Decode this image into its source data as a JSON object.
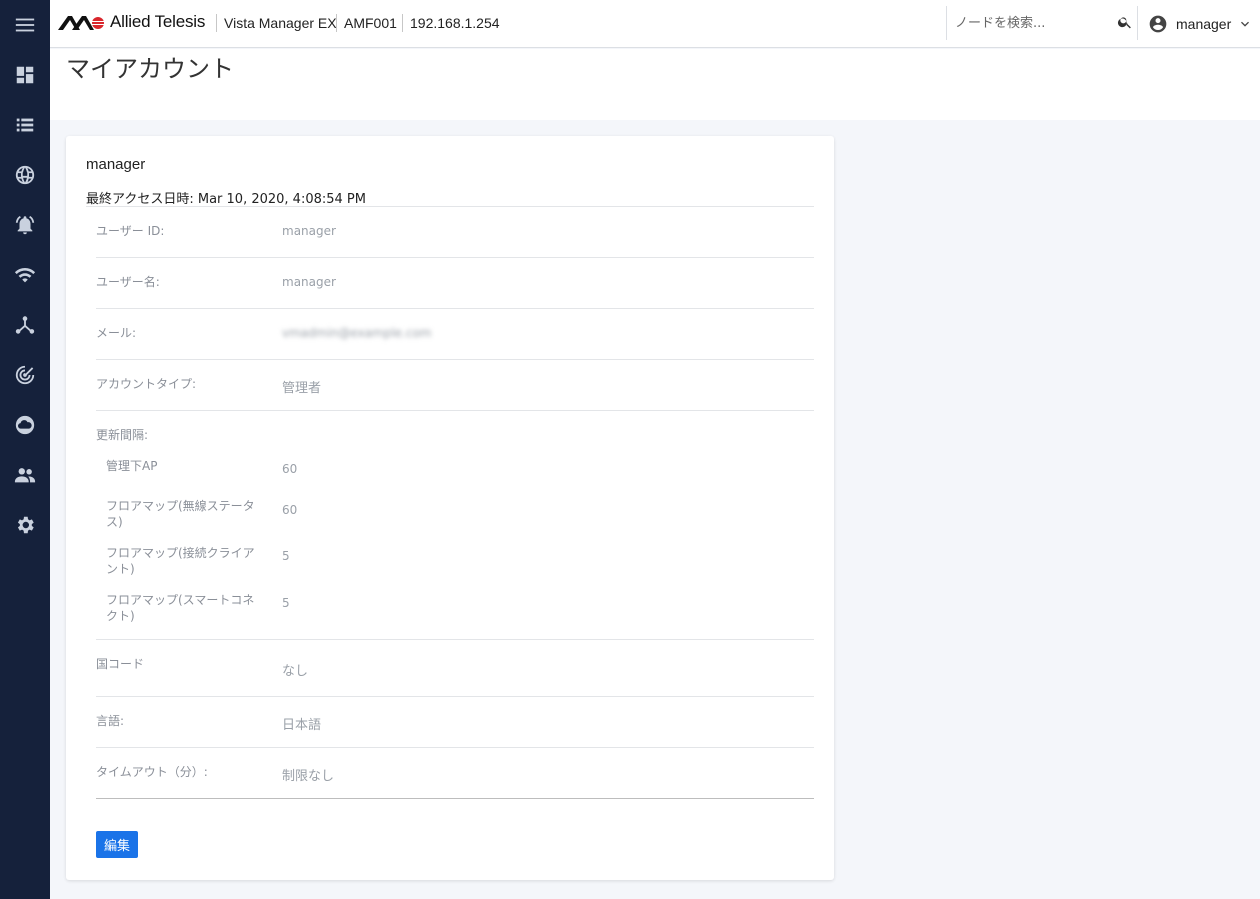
{
  "header": {
    "logo_text": "Allied Telesis",
    "product": "Vista Manager EX",
    "device": "AMF001",
    "ip": "192.168.1.254",
    "search_placeholder": "ノードを検索...",
    "user": "manager"
  },
  "sidebar": {
    "items": [
      {
        "icon": "menu-icon"
      },
      {
        "icon": "dashboard-icon"
      },
      {
        "icon": "list-icon"
      },
      {
        "icon": "globe-icon"
      },
      {
        "icon": "alarm-icon"
      },
      {
        "icon": "wifi-icon"
      },
      {
        "icon": "topology-icon"
      },
      {
        "icon": "radar-icon"
      },
      {
        "icon": "cloud-icon"
      },
      {
        "icon": "users-icon"
      },
      {
        "icon": "gear-icon"
      }
    ]
  },
  "page": {
    "title": "マイアカウント"
  },
  "account": {
    "username_heading": "manager",
    "last_access": "最終アクセス日時: Mar 10, 2020, 4:08:54 PM",
    "user_id_label": "ユーザー ID:",
    "user_id": "manager",
    "user_name_label": "ユーザー名:",
    "user_name": "manager",
    "mail_label": "メール:",
    "mail": "vmadmin@example.com",
    "account_type_label": "アカウントタイプ:",
    "account_type": "管理者",
    "refresh_label": "更新間隔:",
    "refresh": [
      {
        "label": "管理下AP",
        "value": "60"
      },
      {
        "label": "フロアマップ(無線ステータス)",
        "value": "60"
      },
      {
        "label": "フロアマップ(接続クライアント)",
        "value": "5"
      },
      {
        "label": "フロアマップ(スマートコネクト)",
        "value": "5"
      }
    ],
    "country_label": "国コード",
    "country": "なし",
    "language_label": "言語:",
    "language": "日本語",
    "timeout_label": "タイムアウト（分）:",
    "timeout": "制限なし",
    "edit_label": "編集"
  },
  "colors": {
    "sidebar_bg": "#15213b",
    "accent": "#1a73e8",
    "logo_red": "#d9262c"
  }
}
